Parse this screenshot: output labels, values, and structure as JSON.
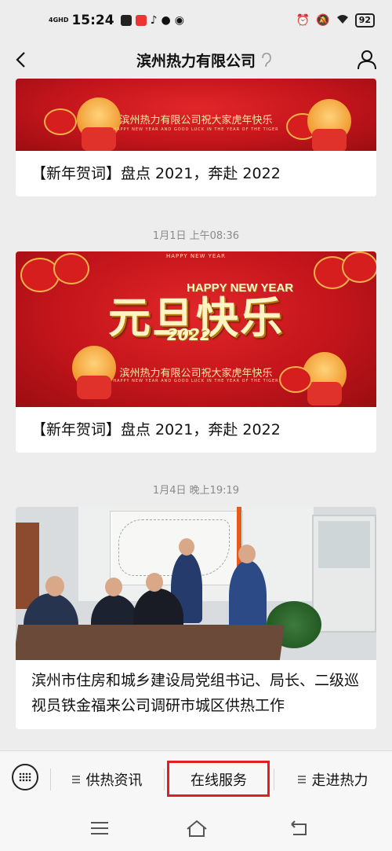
{
  "status_bar": {
    "network": "4GHD",
    "time": "15:24",
    "battery": "92"
  },
  "nav": {
    "title": "滨州热力有限公司"
  },
  "articles": [
    {
      "banner_subtitle": "滨州热力有限公司祝大家虎年快乐",
      "banner_tiny": "HAPPY NEW YEAR AND GOOD LUCK IN THE YEAR OF THE TIGER",
      "title": "【新年贺词】盘点 2021，奔赴 2022"
    },
    {
      "timestamp": "1月1日 上午08:36",
      "banner_top": "HAPPY NEW YEAR",
      "banner_hny": "HAPPY NEW YEAR",
      "banner_main": "元旦快乐",
      "banner_year": "2022",
      "banner_subtitle": "滨州热力有限公司祝大家虎年快乐",
      "banner_tiny": "HAPPY NEW YEAR AND GOOD LUCK IN THE YEAR OF THE TIGER",
      "title": "【新年贺词】盘点 2021，奔赴 2022"
    },
    {
      "timestamp": "1月4日 晚上19:19",
      "title": "滨州市住房和城乡建设局党组书记、局长、二级巡视员铁金福来公司调研市城区供热工作"
    }
  ],
  "bottom_menu": {
    "items": [
      {
        "label": "供热资讯"
      },
      {
        "label": "在线服务"
      },
      {
        "label": "走进热力"
      }
    ]
  },
  "colors": {
    "banner_red": "#c3151b",
    "highlight_border": "#e02020",
    "page_bg": "#ededed"
  }
}
